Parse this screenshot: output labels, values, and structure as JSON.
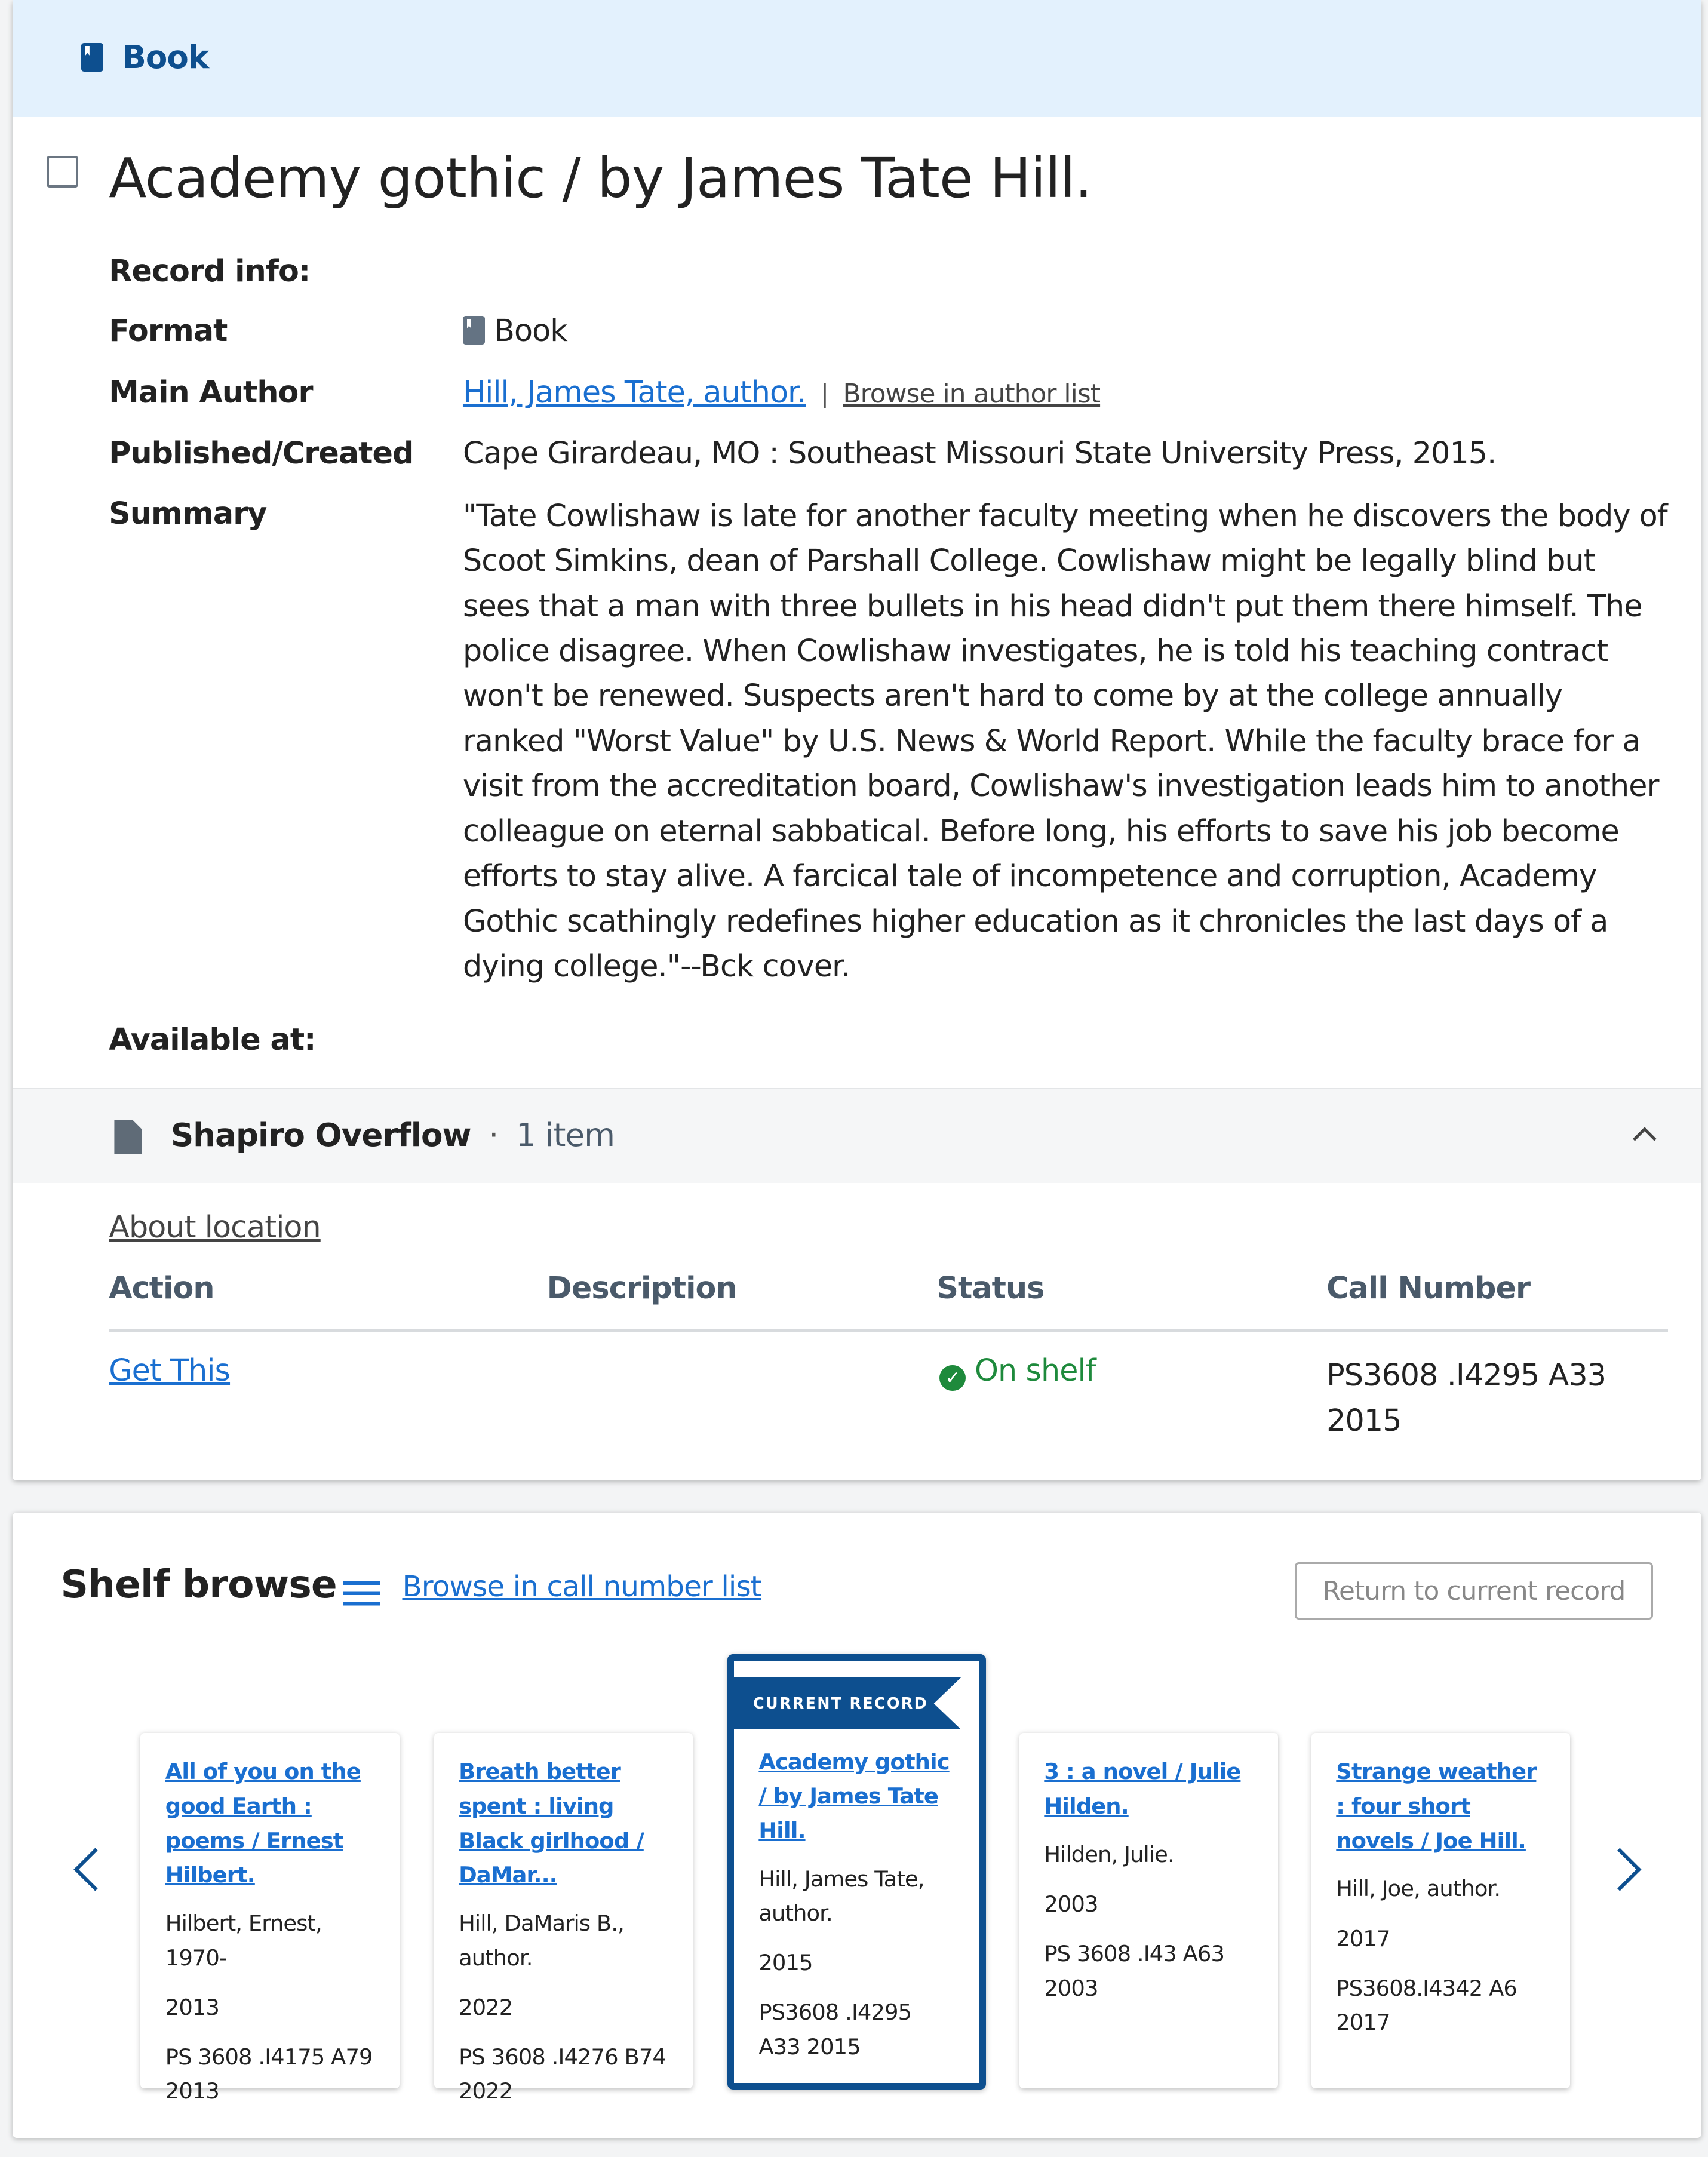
{
  "header": {
    "format_label": "Book",
    "icon": "book-icon"
  },
  "record": {
    "title": "Academy gothic / by James Tate Hill.",
    "record_info_label": "Record info:",
    "fields": {
      "format": {
        "label": "Format",
        "value": "Book"
      },
      "author": {
        "label": "Main Author",
        "value": "Hill, James Tate, author.",
        "separator": "|",
        "browse": "Browse in author list"
      },
      "published": {
        "label": "Published/Created",
        "value": "Cape Girardeau, MO : Southeast Missouri State University Press, 2015."
      },
      "summary": {
        "label": "Summary",
        "value": "\"Tate Cowlishaw is late for another faculty meeting when he discovers the body of Scoot Simkins, dean of Parshall College. Cowlishaw might be legally blind but sees that a man with three bullets in his head didn't put them there himself. The police disagree. When Cowlishaw investigates, he is told his teaching contract won't be renewed. Suspects aren't hard to come by at the college annually ranked \"Worst Value\" by U.S. News & World Report. While the faculty brace for a visit from the accreditation board, Cowlishaw's investigation leads him to another colleague on eternal sabbatical. Before long, his efforts to save his job become efforts to stay alive. A farcical tale of incompetence and corruption, Academy Gothic scathingly redefines higher education as it chronicles the last days of a dying college.\"--Bck cover."
      }
    },
    "available_label": "Available at:"
  },
  "location": {
    "name": "Shapiro Overflow",
    "dot": "·",
    "count": "1 item",
    "about": "About location",
    "columns": [
      "Action",
      "Description",
      "Status",
      "Call Number"
    ],
    "row": {
      "action": "Get This",
      "description": "",
      "status": "On shelf",
      "call_number": "PS3608 .I4295 A33 2015"
    },
    "status_color": "#1e8a3c"
  },
  "shelf": {
    "title": "Shelf browse",
    "browse_link": "Browse in call number list",
    "return_button": "Return to current record",
    "current_badge": "CURRENT RECORD",
    "items": [
      {
        "title": "All of you on the good Earth : poems / Ernest Hilbert.",
        "author": "Hilbert, Ernest, 1970-",
        "year": "2013",
        "call": "PS 3608 .I4175 A79 2013"
      },
      {
        "title": "Breath better spent : living Black girlhood / DaMar...",
        "author": "Hill, DaMaris B., author.",
        "year": "2022",
        "call": "PS 3608 .I4276 B74 2022"
      },
      {
        "title": "Academy gothic / by James Tate Hill.",
        "author": "Hill, James Tate, author.",
        "year": "2015",
        "call": "PS3608 .I4295 A33 2015"
      },
      {
        "title": "3 : a novel / Julie Hilden.",
        "author": "Hilden, Julie.",
        "year": "2003",
        "call": "PS 3608 .I43 A63 2003"
      },
      {
        "title": "Strange weather : four short novels / Joe Hill.",
        "author": "Hill, Joe, author.",
        "year": "2017",
        "call": "PS3608.I4342 A6 2017"
      }
    ]
  },
  "colors": {
    "accent": "#0d4f8f",
    "link": "#1a6fd0",
    "header_bg": "#e3f1fd"
  }
}
